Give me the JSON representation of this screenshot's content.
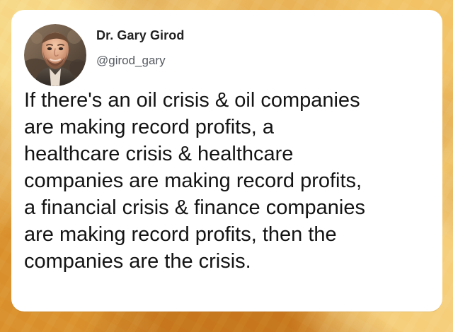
{
  "tweet": {
    "author_name": "Dr. Gary Girod",
    "author_handle": "@girod_gary",
    "text": "If there's an oil crisis & oil companies\nare making record profits, a\nhealthcare crisis & healthcare\ncompanies are making record profits,\na financial crisis & finance companies\nare making record profits, then the\ncompanies are the crisis."
  },
  "colors": {
    "card_background": "#ffffff",
    "name_color": "#222222",
    "handle_color": "#555a60",
    "text_color": "#141414",
    "background_gold": "#d9922f"
  }
}
